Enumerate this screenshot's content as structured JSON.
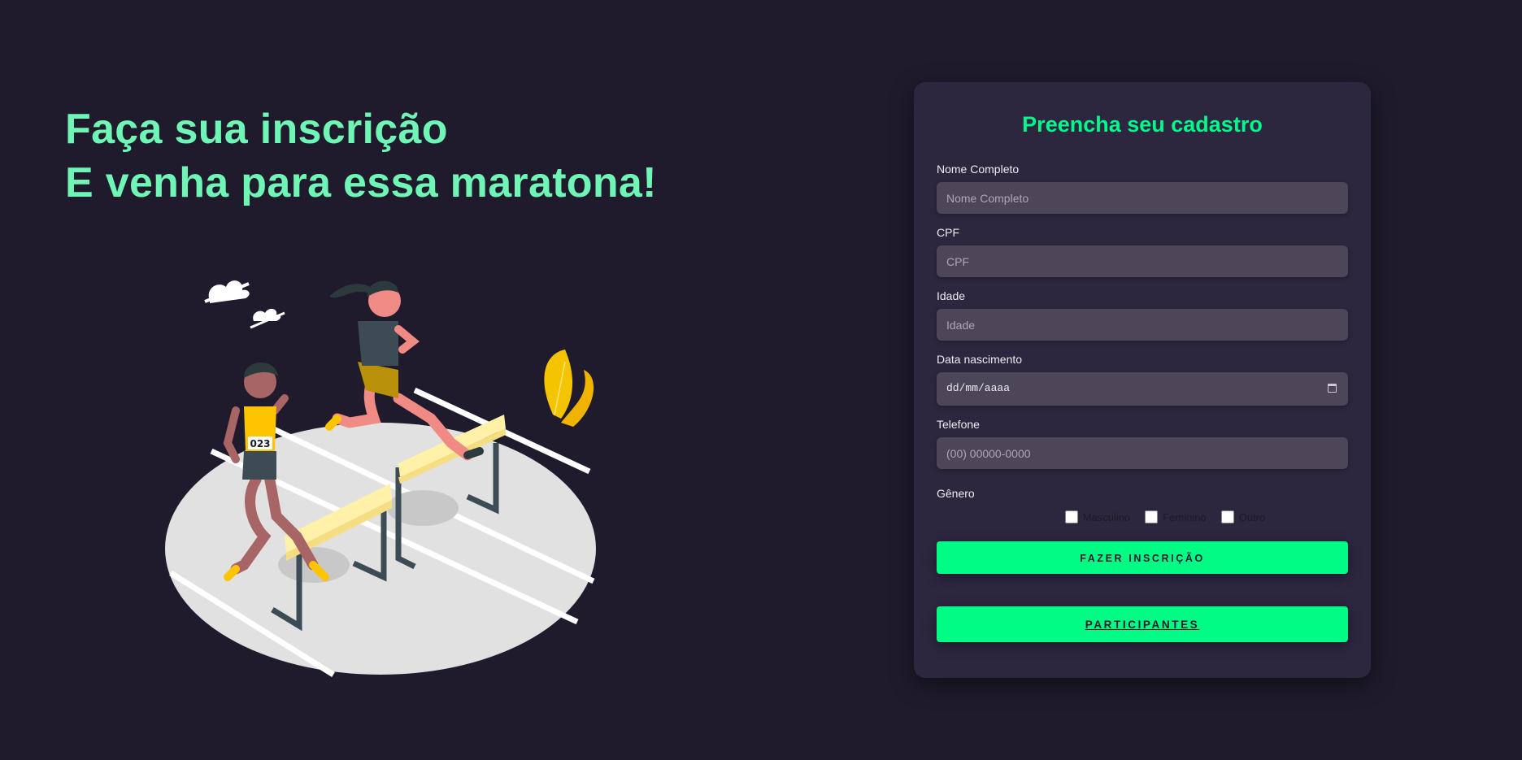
{
  "hero": {
    "line1": "Faça sua inscrição",
    "line2": "E venha para essa maratona!"
  },
  "illustration": {
    "bib_number": "023"
  },
  "form": {
    "title": "Preencha seu cadastro",
    "fields": {
      "nome": {
        "label": "Nome Completo",
        "placeholder": "Nome Completo"
      },
      "cpf": {
        "label": "CPF",
        "placeholder": "CPF"
      },
      "idade": {
        "label": "Idade",
        "placeholder": "Idade"
      },
      "nascimento": {
        "label": "Data nascimento",
        "placeholder": "dd/mm/aaaa",
        "icon": "calendar-icon"
      },
      "telefone": {
        "label": "Telefone",
        "placeholder": "(00) 00000-0000"
      }
    },
    "gender": {
      "label": "Gênero",
      "options": [
        "Masculino",
        "Feminino",
        "Outro"
      ]
    },
    "submit_label": "FAZER INSCRIÇÃO",
    "participants_label": "PARTICIPANTES"
  },
  "colors": {
    "background": "#1f1b2c",
    "card": "#2c263f",
    "accent": "#00f98a",
    "hero_text": "#6ff5b5",
    "input": "#4d4658"
  }
}
